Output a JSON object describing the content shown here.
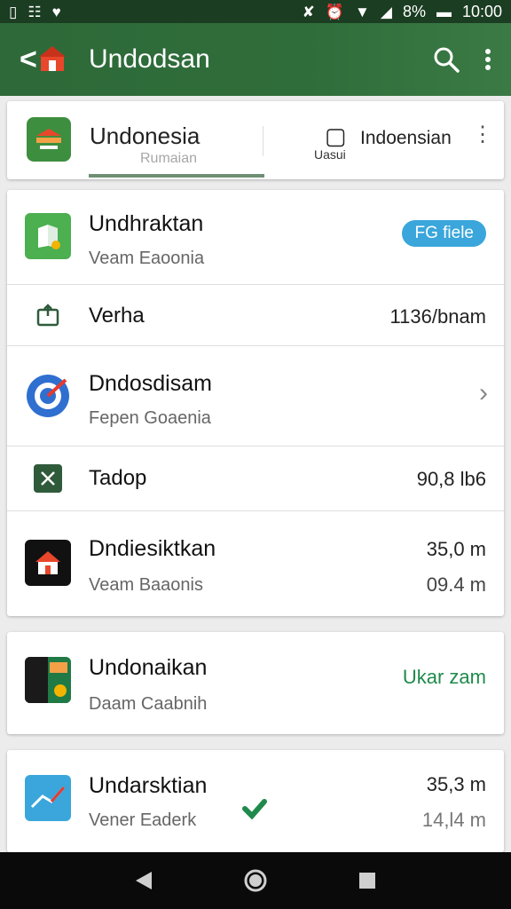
{
  "status_bar": {
    "time": "10:00",
    "battery": "8%",
    "left_icons": [
      "sim-icon",
      "message-icon",
      "heart-icon"
    ],
    "right_icons": [
      "mute-icon",
      "alarm-icon",
      "wifi-icon",
      "signal-icon",
      "battery-icon"
    ]
  },
  "toolbar": {
    "title": "Undodsan",
    "color": "#2f6b3a"
  },
  "header_card": {
    "title": "Undonesia",
    "tab_label": "Rumaian",
    "secondary_label": "Uasui",
    "secondary_title": "Indoensian"
  },
  "list": {
    "item1": {
      "title": "Undhraktan",
      "subtitle": "Veam Eaoonia",
      "badge": "FG fiele"
    },
    "row_verha": {
      "label": "Verha",
      "value": "1136/bnam"
    },
    "item2": {
      "title": "Dndosdisam",
      "subtitle": "Fepen Goaenia"
    },
    "row_tadop": {
      "label": "Tadop",
      "value": "90,8 lb6"
    },
    "item3": {
      "title": "Dndiesiktkan",
      "subtitle": "Veam Baaonis",
      "value1": "35,0 m",
      "value2": "09.4 m"
    }
  },
  "card3": {
    "title": "Undonaikan",
    "subtitle": "Daam Caabnih",
    "action": "Ukar zam",
    "action_color": "#1f8a4c"
  },
  "card4": {
    "title": "Undarsktian",
    "subtitle": "Vener Eaderk",
    "value1": "35,3 m",
    "value2": "14,l4 m"
  }
}
